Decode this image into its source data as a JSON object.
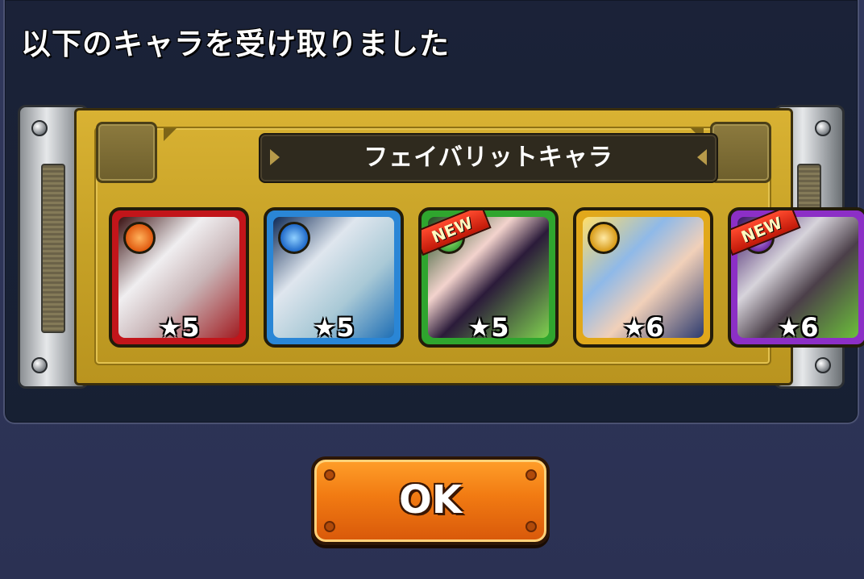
{
  "header": {
    "title": "以下のキャラを受け取りました"
  },
  "banner": {
    "label": "フェイバリットキャラ"
  },
  "characters": [
    {
      "stars": "★5",
      "theme": "#c2151a",
      "element_color": "#e05a10",
      "is_new": false,
      "icon": "fire-element-icon"
    },
    {
      "stars": "★5",
      "theme": "#2a86d6",
      "element_color": "#1f69c9",
      "is_new": false,
      "icon": "water-element-icon"
    },
    {
      "stars": "★5",
      "theme": "#2fa52e",
      "element_color": "#3ea23a",
      "is_new": true,
      "icon": "wood-element-icon",
      "badge": "NEW"
    },
    {
      "stars": "★6",
      "theme": "#e1a81b",
      "element_color": "#d79a16",
      "is_new": false,
      "icon": "light-element-icon"
    },
    {
      "stars": "★6",
      "theme": "#8c2fc6",
      "element_color": "#6b2aa2",
      "is_new": true,
      "icon": "dark-element-icon",
      "badge": "NEW"
    }
  ],
  "ok_button": {
    "label": "OK"
  }
}
